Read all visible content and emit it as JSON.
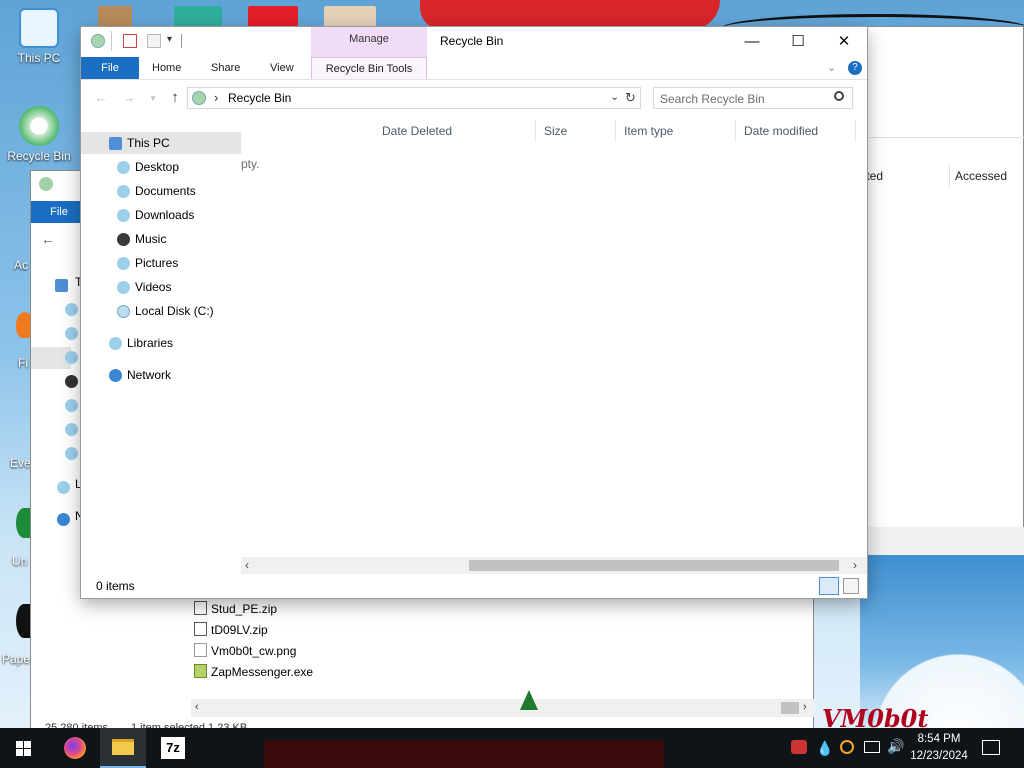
{
  "desktop": {
    "icons": [
      {
        "label": "This PC"
      },
      {
        "label": "Recycle Bin"
      }
    ],
    "partial_labels": [
      "Ac",
      "Fi",
      "Eve",
      "Un",
      "Pape"
    ],
    "brand_text": "VM0b0t"
  },
  "back_window": {
    "ribbon_file_label": "File",
    "column_created": "eated",
    "column_accessed": "Accessed",
    "files": [
      {
        "name": "Stud_PE.zip"
      },
      {
        "name": "tD09LV.zip"
      },
      {
        "name": "Vm0b0t_cw.png"
      },
      {
        "name": "ZapMessenger.exe"
      }
    ],
    "status_items": "25,280 items",
    "status_selected": "1 item selected  1.23 KB"
  },
  "window": {
    "title": "Recycle Bin",
    "context_tab_group": "Manage",
    "tabs": {
      "file": "File",
      "home": "Home",
      "share": "Share",
      "view": "View",
      "context": "Recycle Bin Tools"
    },
    "address": {
      "separator": "›",
      "path": "Recycle Bin"
    },
    "search_placeholder": "Search Recycle Bin",
    "columns": {
      "date_deleted": "Date Deleted",
      "size": "Size",
      "item_type": "Item type",
      "date_modified": "Date modified"
    },
    "empty_text_fragment": "pty.",
    "nav": {
      "this_pc": "This PC",
      "desktop": "Desktop",
      "documents": "Documents",
      "downloads": "Downloads",
      "music": "Music",
      "pictures": "Pictures",
      "videos": "Videos",
      "local_disk": "Local Disk (C:)",
      "libraries": "Libraries",
      "network": "Network"
    },
    "status": "0 items"
  },
  "taskbar": {
    "time": "8:54 PM",
    "date": "12/23/2024",
    "seven_zip_label": "7z"
  },
  "colors": {
    "accent_blue": "#1a6fc2",
    "context_tab": "#f0dcf7",
    "taskbar": "#0f1419"
  }
}
